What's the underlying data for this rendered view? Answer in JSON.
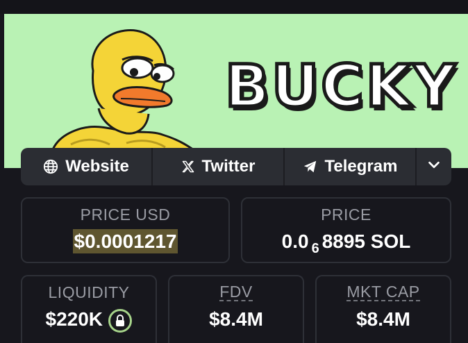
{
  "banner": {
    "title": "BUCKY",
    "colors": {
      "background": "#b9f2b4"
    }
  },
  "social": [
    {
      "label": "Website",
      "icon": "globe-icon"
    },
    {
      "label": "Twitter",
      "icon": "x-logo-icon"
    },
    {
      "label": "Telegram",
      "icon": "telegram-icon"
    }
  ],
  "social_more_icon": "chevron-down-icon",
  "stats": {
    "price_usd": {
      "label": "PRICE USD",
      "value": "$0.0001217"
    },
    "price": {
      "label": "PRICE",
      "prefix": "0.0",
      "zeros": "6",
      "rest": "8895 SOL"
    },
    "liquidity": {
      "label": "LIQUIDITY",
      "value": "$220K",
      "icon": "lock-icon"
    },
    "fdv": {
      "label": "FDV",
      "value": "$8.4M"
    },
    "mkt_cap": {
      "label": "MKT CAP",
      "value": "$8.4M"
    }
  },
  "colors": {
    "page_bg": "#17171d",
    "card_border": "#2e3037",
    "label_text": "#9a9ca4",
    "highlight": "#5f5630",
    "lock_ring": "#a6d38a"
  }
}
